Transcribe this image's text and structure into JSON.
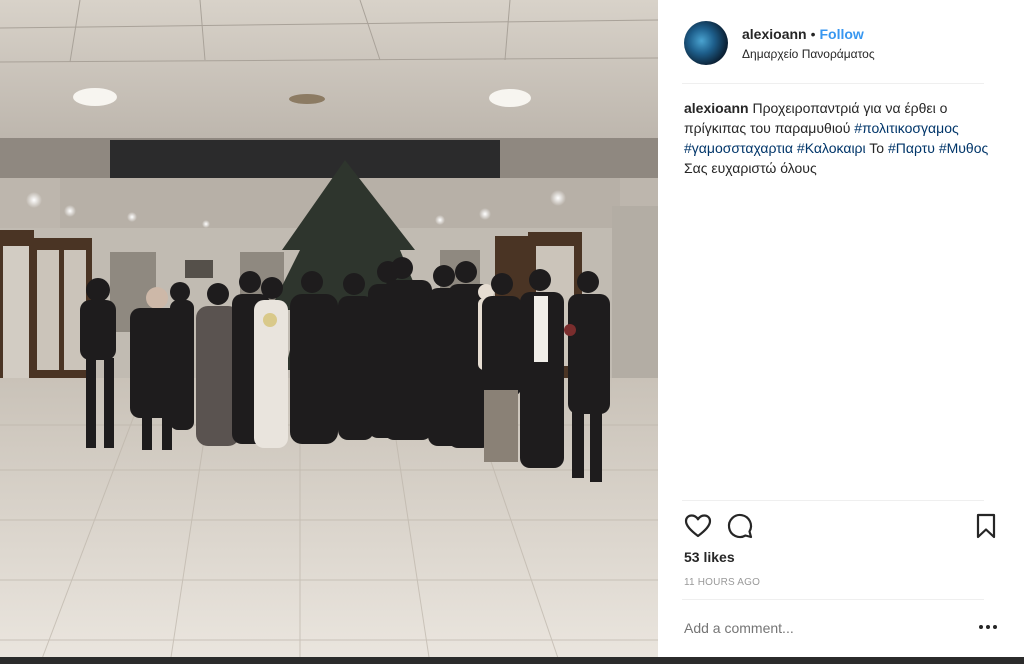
{
  "post": {
    "username": "alexioann",
    "separator": "•",
    "follow_label": "Follow",
    "location": "Δημαρχείο Πανοράματος",
    "caption": {
      "user": "alexioann",
      "text_1": "Προχειροπαντριά για να έρθει ο πρίγκιπας του παραμυθιού",
      "tag_1": "#πολιτικοσγαμος",
      "tag_2": "#γαμοσσταχαρτια",
      "tag_3": "#Καλοκαιρι",
      "text_2": "Το",
      "tag_4": "#Παρτυ",
      "tag_5": "#Μυθος",
      "text_3": "Σας ευχαριστώ όλους"
    },
    "likes": "53 likes",
    "time_ago": "11 HOURS AGO",
    "comment_placeholder": "Add a comment...",
    "icons": {
      "like": "heart-icon",
      "comment": "comment-bubble-icon",
      "save": "bookmark-icon",
      "more": "more-options-icon"
    },
    "colors": {
      "follow": "#3897f0",
      "hashtag": "#003569",
      "muted": "#999999"
    }
  }
}
